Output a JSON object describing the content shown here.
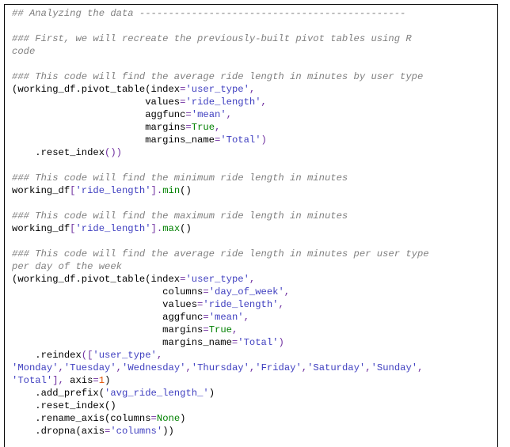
{
  "document": {
    "type": "code-notebook",
    "language": "python-in-rmarkdown",
    "colors": {
      "background": "#ffffff",
      "border": "#000000",
      "comment": "#808080",
      "string": "#4040c0",
      "keyword": "#008000",
      "function": "#008000",
      "number": "#e05000",
      "operator": "#7030a0",
      "plain": "#000000"
    }
  },
  "lines": {
    "l1": "## Analyzing the data ----------------------------------------------",
    "l2": "",
    "l3": "### First, we will recreate the previously-built pivot tables using R",
    "l4": "code",
    "l5": "",
    "l6": "### This code will find the average ride length in minutes by user type",
    "l7_a": "(working_df.pivot_table(index",
    "l7_b": "=",
    "l7_c": "'user_type'",
    "l7_d": ",",
    "l8_a": "                       values",
    "l8_b": "=",
    "l8_c": "'ride_length'",
    "l8_d": ",",
    "l9_a": "                       aggfunc",
    "l9_b": "=",
    "l9_c": "'mean'",
    "l9_d": ",",
    "l10_a": "                       margins",
    "l10_b": "=",
    "l10_c": "True",
    "l10_d": ",",
    "l11_a": "                       margins_name",
    "l11_b": "=",
    "l11_c": "'Total'",
    "l11_d": ")",
    "l12_a": "    .reset_index",
    "l12_b": "())",
    "l13": "",
    "l14": "### This code will find the minimum ride length in minutes",
    "l15_a": "working_df",
    "l15_b": "[",
    "l15_c": "'ride_length'",
    "l15_d": "].",
    "l15_e": "min",
    "l15_f": "()",
    "l16": "",
    "l17": "### This code will find the maximum ride length in minutes",
    "l18_a": "working_df",
    "l18_b": "[",
    "l18_c": "'ride_length'",
    "l18_d": "].",
    "l18_e": "max",
    "l18_f": "()",
    "l19": "",
    "l20": "### This code will find the average ride length in minutes per user type",
    "l21": "per day of the week",
    "l22_a": "(working_df.pivot_table(index",
    "l22_b": "=",
    "l22_c": "'user_type'",
    "l22_d": ",",
    "l23_a": "                          columns",
    "l23_b": "=",
    "l23_c": "'day_of_week'",
    "l23_d": ",",
    "l24_a": "                          values",
    "l24_b": "=",
    "l24_c": "'ride_length'",
    "l24_d": ",",
    "l25_a": "                          aggfunc",
    "l25_b": "=",
    "l25_c": "'mean'",
    "l25_d": ",",
    "l26_a": "                          margins",
    "l26_b": "=",
    "l26_c": "True",
    "l26_d": ",",
    "l27_a": "                          margins_name",
    "l27_b": "=",
    "l27_c": "'Total'",
    "l27_d": ")",
    "l28_a": "    .reindex",
    "l28_b": "([",
    "l28_c": "'user_type'",
    "l28_d": ",",
    "l29_a": "'Monday'",
    "l29_b": ",",
    "l29_c": "'Tuesday'",
    "l29_d": ",",
    "l29_e": "'Wednesday'",
    "l29_f": ",",
    "l29_g": "'Thursday'",
    "l29_h": ",",
    "l29_i": "'Friday'",
    "l29_j": ",",
    "l29_k": "'Saturday'",
    "l29_l": ",",
    "l29_m": "'Sunday'",
    "l29_n": ",",
    "l30_a": "'Total'",
    "l30_b": "],",
    "l30_c": " axis",
    "l30_d": "=",
    "l30_e": "1",
    "l30_f": ")",
    "l31_a": "    .add_prefix",
    "l31_b": "(",
    "l31_c": "'avg_ride_length_'",
    "l31_d": ")",
    "l32_a": "    .reset_index",
    "l32_b": "()",
    "l33_a": "    .rename_axis",
    "l33_b": "(columns",
    "l33_c": "=",
    "l33_d": "None",
    "l33_e": ")",
    "l34_a": "    .dropna",
    "l34_b": "(axis",
    "l34_c": "=",
    "l34_d": "'columns'",
    "l34_e": "))"
  }
}
